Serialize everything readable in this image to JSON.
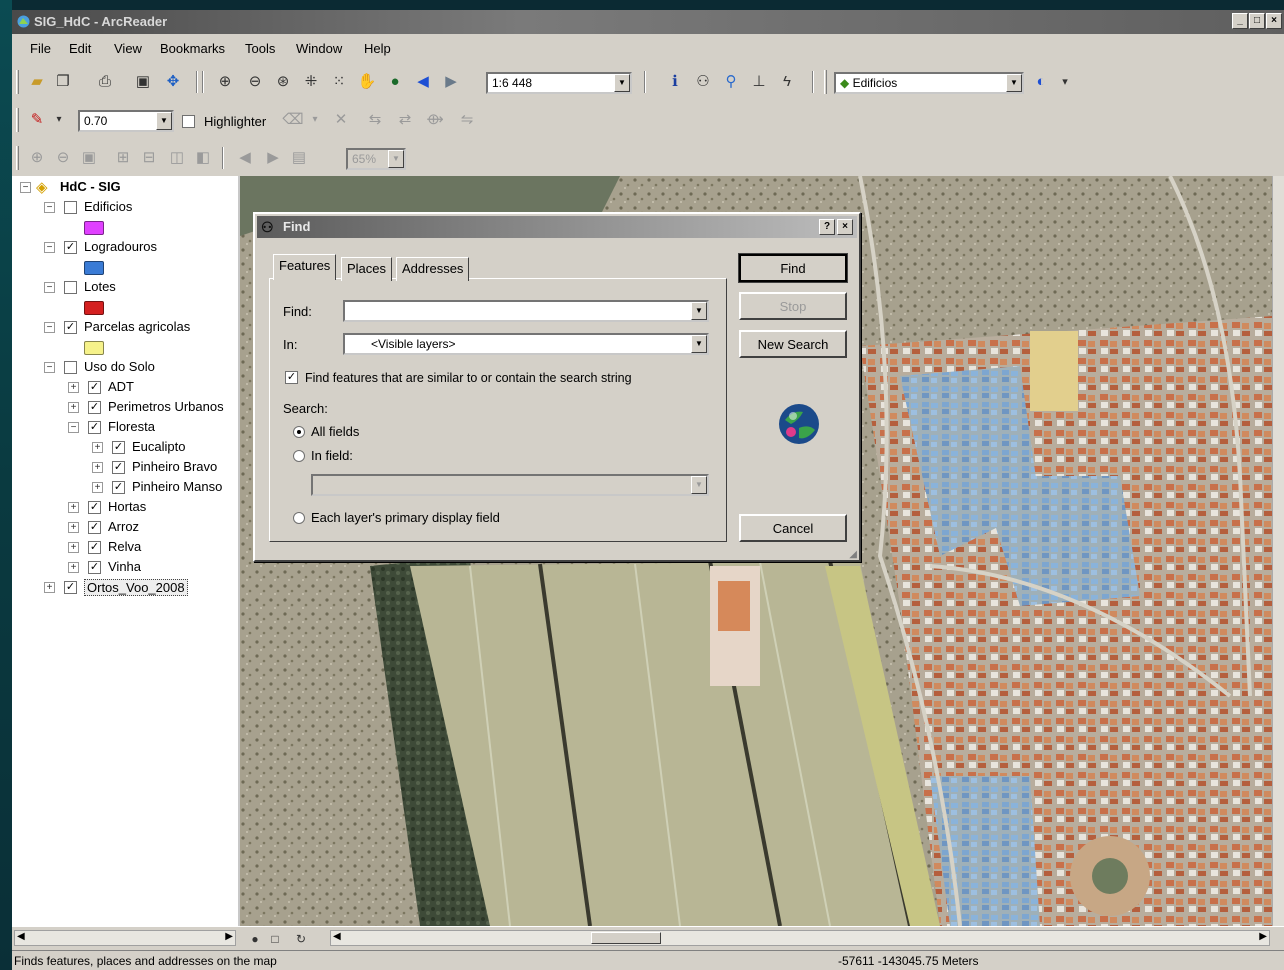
{
  "window": {
    "title": "SIG_HdC - ArcReader",
    "controls": [
      "_",
      "□",
      "×"
    ]
  },
  "menubar": {
    "items": [
      "File",
      "Edit",
      "View",
      "Bookmarks",
      "Tools",
      "Window",
      "Help"
    ]
  },
  "toolbar": {
    "scale": "1:6 448",
    "layer": "Edificios",
    "highlight_value": "0.70",
    "highlighter_label": "Highlighter",
    "zoom_value": "65%"
  },
  "toc": {
    "root": "HdC - SIG",
    "layers": [
      {
        "label": "Edificios",
        "checked": false,
        "level": 0,
        "expand": "−",
        "symbol": "#e040ff"
      },
      {
        "label": "Logradouros",
        "checked": true,
        "level": 0,
        "expand": "−",
        "symbol": "#3a7bd5"
      },
      {
        "label": "Lotes",
        "checked": false,
        "level": 0,
        "expand": "−",
        "symbol": "#d42020"
      },
      {
        "label": "Parcelas agricolas",
        "checked": true,
        "level": 0,
        "expand": "−",
        "symbol": "#f6f28a"
      },
      {
        "label": "Uso do Solo",
        "checked": false,
        "level": 0,
        "expand": "−"
      },
      {
        "label": "ADT",
        "checked": true,
        "level": 1,
        "expand": "+"
      },
      {
        "label": "Perimetros Urbanos",
        "checked": true,
        "level": 1,
        "expand": "+"
      },
      {
        "label": "Floresta",
        "checked": true,
        "level": 1,
        "expand": "−"
      },
      {
        "label": "Eucalipto",
        "checked": true,
        "level": 2,
        "expand": "+"
      },
      {
        "label": "Pinheiro Bravo",
        "checked": true,
        "level": 2,
        "expand": "+"
      },
      {
        "label": "Pinheiro Manso",
        "checked": true,
        "level": 2,
        "expand": "+"
      },
      {
        "label": "Hortas",
        "checked": true,
        "level": 1,
        "expand": "+"
      },
      {
        "label": "Arroz",
        "checked": true,
        "level": 1,
        "expand": "+"
      },
      {
        "label": "Relva",
        "checked": true,
        "level": 1,
        "expand": "+"
      },
      {
        "label": "Vinha",
        "checked": true,
        "level": 1,
        "expand": "+"
      },
      {
        "label": "Ortos_Voo_2008",
        "checked": true,
        "level": 0,
        "expand": "+"
      }
    ]
  },
  "dialog": {
    "title": "Find",
    "help_btn": "?",
    "close_btn": "×",
    "tabs": [
      "Features",
      "Places",
      "Addresses"
    ],
    "find_label": "Find:",
    "find_value": "",
    "in_label": "In:",
    "in_value": "<Visible layers>",
    "similar_label": "Find features that are similar to or contain the search string",
    "search_label": "Search:",
    "all_fields_label": "All fields",
    "in_field_label": "In field:",
    "primary_field_label": "Each layer's primary display field",
    "buttons": {
      "find": "Find",
      "stop": "Stop",
      "new_search": "New Search",
      "cancel": "Cancel"
    }
  },
  "status": {
    "message": "Finds features, places and addresses on the map",
    "coords": "-57611  -143045.75 Meters"
  }
}
